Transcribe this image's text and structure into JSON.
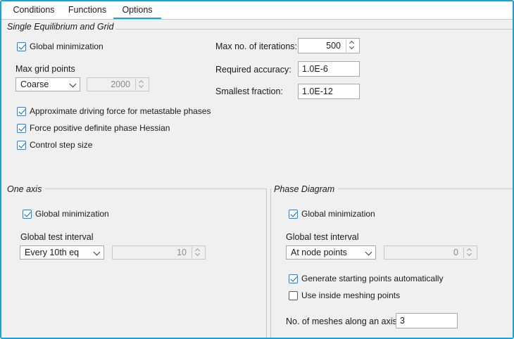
{
  "tabs": [
    {
      "label": "Conditions",
      "active": false
    },
    {
      "label": "Functions",
      "active": false
    },
    {
      "label": "Options",
      "active": true
    }
  ],
  "single_eq": {
    "title": "Single Equilibrium and Grid",
    "global_min": {
      "label": "Global minimization",
      "checked": true
    },
    "max_grid_points": {
      "label": "Max grid points",
      "selected": "Coarse",
      "value": "2000",
      "enabled": false
    },
    "max_iterations": {
      "label": "Max no. of iterations:",
      "value": "500"
    },
    "required_accuracy": {
      "label": "Required accuracy:",
      "value": "1.0E-6"
    },
    "smallest_fraction": {
      "label": "Smallest fraction:",
      "value": "1.0E-12"
    },
    "approx_driving_force": {
      "label": "Approximate driving force for metastable phases",
      "checked": true
    },
    "force_hessian": {
      "label": "Force positive definite phase Hessian",
      "checked": true
    },
    "control_step": {
      "label": "Control step size",
      "checked": true
    }
  },
  "one_axis": {
    "title": "One axis",
    "global_min": {
      "label": "Global minimization",
      "checked": true
    },
    "test_interval": {
      "label": "Global test interval",
      "selected": "Every 10th eq",
      "value": "10",
      "enabled": false
    }
  },
  "phase_diagram": {
    "title": "Phase Diagram",
    "global_min": {
      "label": "Global minimization",
      "checked": true
    },
    "test_interval": {
      "label": "Global test interval",
      "selected": "At node points",
      "value": "0",
      "enabled": false
    },
    "gen_start_points": {
      "label": "Generate starting points automatically",
      "checked": true
    },
    "inside_meshing": {
      "label": "Use inside meshing points",
      "checked": false
    },
    "meshes": {
      "label": "No. of meshes along an axis:",
      "value": "3"
    }
  }
}
